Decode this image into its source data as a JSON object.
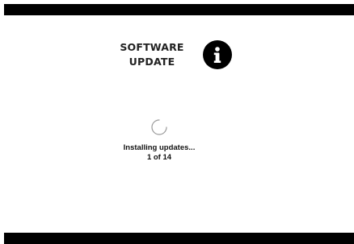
{
  "title": {
    "line1": "SOFTWARE",
    "line2": "UPDATE"
  },
  "icons": {
    "info": "info-icon",
    "spinner": "loading-spinner-icon"
  },
  "status": {
    "message": "Installing updates...",
    "progress": "1 of 14"
  },
  "colors": {
    "background": "#ffffff",
    "bars": "#000000",
    "text": "#111111"
  }
}
